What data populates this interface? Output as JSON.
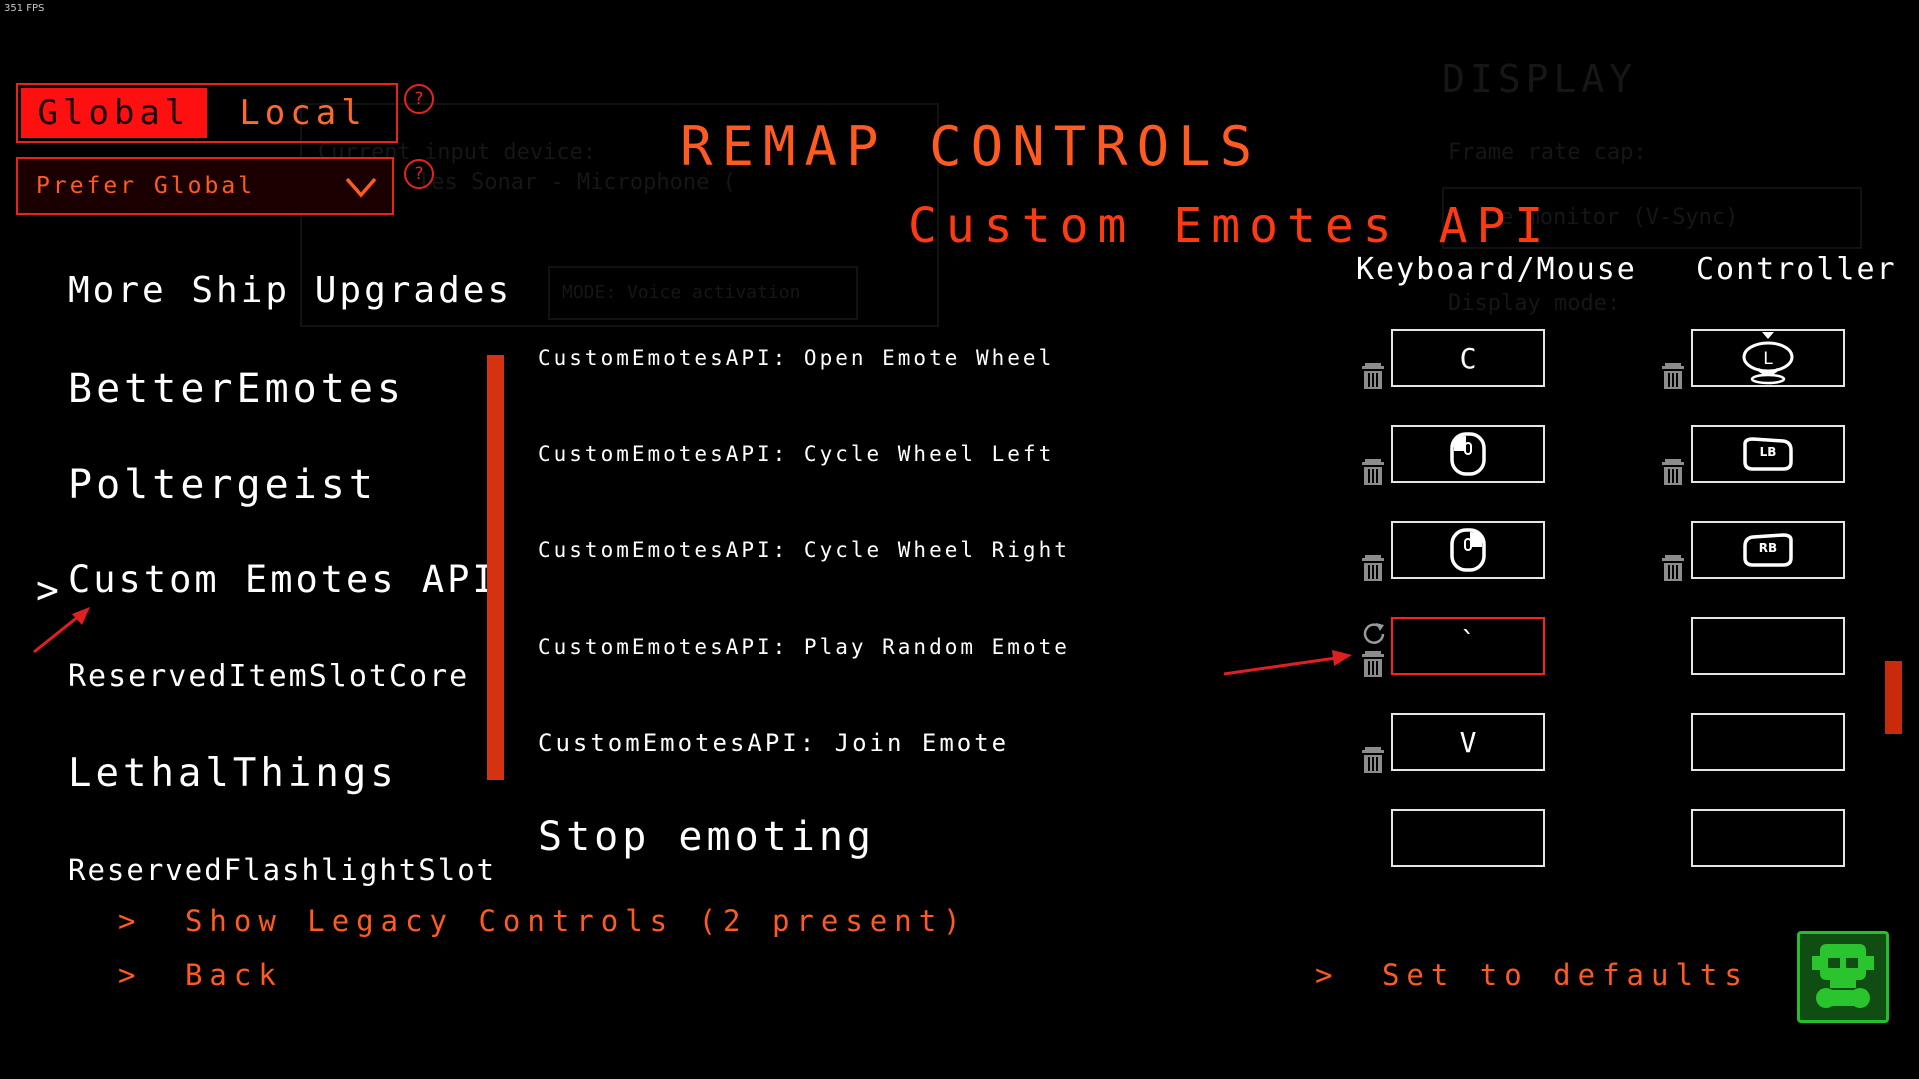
{
  "fps": "351 FPS",
  "background": {
    "display_title": "DISPLAY",
    "frame_rate_label": "Frame rate cap:",
    "frame_rate_value": "e monitor (V-Sync)",
    "display_mode_label": "Display mode:",
    "input_device_label": "Current input device:",
    "input_device_value": "les Sonar - Microphone (",
    "voice_mode": "MODE: Voice activation"
  },
  "scope": {
    "tabs": [
      {
        "label": "Global",
        "active": true
      },
      {
        "label": "Local",
        "active": false
      }
    ],
    "help_icon": "?",
    "dropdown_value": "Prefer Global"
  },
  "mods": [
    {
      "label": "More Ship Upgrades"
    },
    {
      "label": "BetterEmotes"
    },
    {
      "label": "Poltergeist"
    },
    {
      "label": "Custom Emotes API",
      "selected": true
    },
    {
      "label": "ReservedItemSlotCore"
    },
    {
      "label": "LethalThings"
    },
    {
      "label": "ReservedFlashlightSlot"
    }
  ],
  "selected_chevron": ">",
  "header": {
    "title": "REMAP CONTROLS",
    "subtitle": "Custom Emotes API",
    "col_keyboard": "Keyboard/Mouse",
    "col_controller": "Controller"
  },
  "bindings": [
    {
      "action": "CustomEmotesAPI: Open Emote Wheel",
      "kbm": "C",
      "kbm_icon": null,
      "controller_icon": "left-stick-press-icon"
    },
    {
      "action": "CustomEmotesAPI: Cycle Wheel Left",
      "kbm": "",
      "kbm_icon": "mouse-left-button-icon",
      "controller_icon": "LB"
    },
    {
      "action": "CustomEmotesAPI: Cycle Wheel Right",
      "kbm": "",
      "kbm_icon": "mouse-right-button-icon",
      "controller_icon": "RB"
    },
    {
      "action": "CustomEmotesAPI: Play Random Emote",
      "kbm": "`",
      "kbm_icon": null,
      "controller_icon": null,
      "highlighted": true
    },
    {
      "action": "CustomEmotesAPI: Join Emote",
      "kbm": "V",
      "kbm_icon": null,
      "controller_icon": null
    },
    {
      "action": "Stop emoting",
      "kbm": "",
      "kbm_icon": null,
      "controller_icon": null
    }
  ],
  "footer": {
    "legacy": "Show Legacy Controls (2 present)",
    "back": "Back",
    "defaults": "Set to defaults",
    "chevron": ">"
  },
  "colors": {
    "accent": "#ff5a1f",
    "tab_active_bg": "#ff1010",
    "border_red": "#e8241a",
    "highlight_arrow": "#e02020",
    "logo_green": "#23c02a"
  }
}
